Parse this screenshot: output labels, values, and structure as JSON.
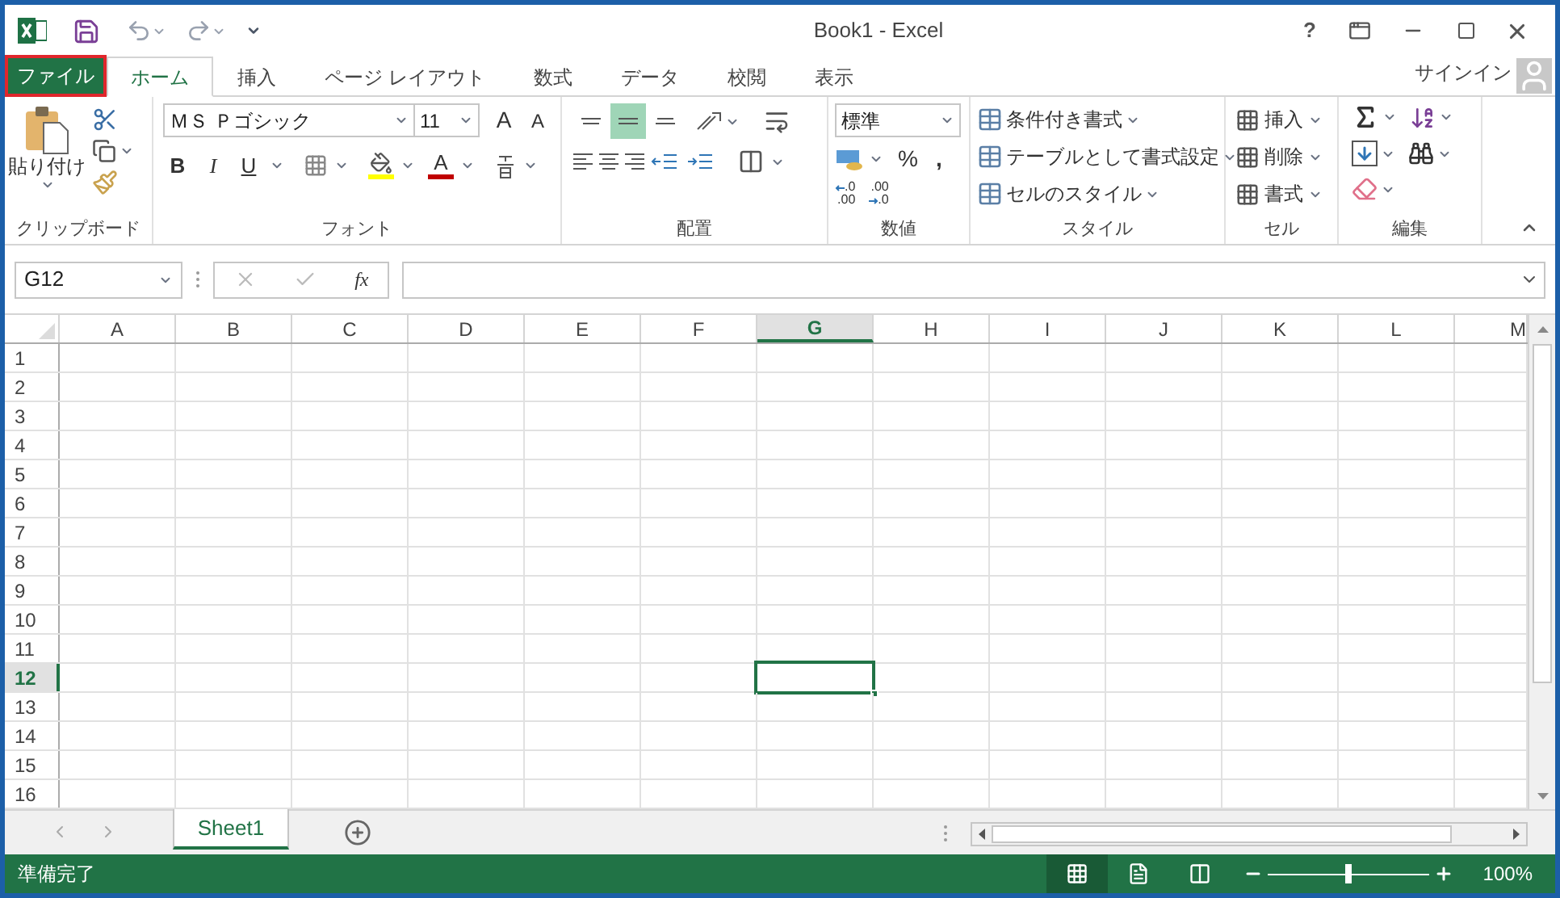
{
  "window": {
    "title": "Book1 - Excel",
    "help": "?"
  },
  "sign_in": "サインイン",
  "tabs": [
    {
      "label": "ファイル",
      "kind": "file",
      "selected": false
    },
    {
      "label": "ホーム",
      "kind": "tab",
      "selected": true
    },
    {
      "label": "挿入",
      "kind": "tab",
      "selected": false
    },
    {
      "label": "ページ レイアウト",
      "kind": "tab",
      "selected": false
    },
    {
      "label": "数式",
      "kind": "tab",
      "selected": false
    },
    {
      "label": "データ",
      "kind": "tab",
      "selected": false
    },
    {
      "label": "校閲",
      "kind": "tab",
      "selected": false
    },
    {
      "label": "表示",
      "kind": "tab",
      "selected": false
    }
  ],
  "ribbon": {
    "clipboard": {
      "label": "クリップボード",
      "paste": "貼り付け"
    },
    "font": {
      "label": "フォント",
      "font_name": "ＭＳ Ｐゴシック",
      "font_size": "11",
      "grow": "A",
      "shrink": "A",
      "bold": "B",
      "italic": "I",
      "underline": "U",
      "font_color": "A"
    },
    "alignment": {
      "label": "配置",
      "vertical": [
        {
          "kind": "top",
          "selected": false
        },
        {
          "kind": "middle",
          "selected": true
        },
        {
          "kind": "bottom",
          "selected": false
        }
      ]
    },
    "number": {
      "label": "数値",
      "format": "標準",
      "percent": "%",
      "comma": ",",
      "decimals": [
        {
          "kind": "increase",
          "top": ".0",
          "bottom": ".00"
        },
        {
          "kind": "decrease",
          "top": ".00",
          "bottom": ".0"
        }
      ]
    },
    "styles": {
      "label": "スタイル",
      "items": [
        "条件付き書式",
        "テーブルとして書式設定",
        "セルのスタイル"
      ]
    },
    "cells": {
      "label": "セル",
      "items": [
        "挿入",
        "削除",
        "書式"
      ]
    },
    "editing": {
      "label": "編集"
    }
  },
  "formula_bar": {
    "name_box": "G12",
    "function_label": "fx"
  },
  "sheet": {
    "columns": [
      {
        "label": "A",
        "selected": false
      },
      {
        "label": "B",
        "selected": false
      },
      {
        "label": "C",
        "selected": false
      },
      {
        "label": "D",
        "selected": false
      },
      {
        "label": "E",
        "selected": false
      },
      {
        "label": "F",
        "selected": false
      },
      {
        "label": "G",
        "selected": true
      },
      {
        "label": "H",
        "selected": false
      },
      {
        "label": "I",
        "selected": false
      },
      {
        "label": "J",
        "selected": false
      },
      {
        "label": "K",
        "selected": false
      },
      {
        "label": "L",
        "selected": false
      },
      {
        "label": "M",
        "selected": false
      }
    ],
    "rows": [
      {
        "label": "1",
        "selected": false
      },
      {
        "label": "2",
        "selected": false
      },
      {
        "label": "3",
        "selected": false
      },
      {
        "label": "4",
        "selected": false
      },
      {
        "label": "5",
        "selected": false
      },
      {
        "label": "6",
        "selected": false
      },
      {
        "label": "7",
        "selected": false
      },
      {
        "label": "8",
        "selected": false
      },
      {
        "label": "9",
        "selected": false
      },
      {
        "label": "10",
        "selected": false
      },
      {
        "label": "11",
        "selected": false
      },
      {
        "label": "12",
        "selected": true
      },
      {
        "label": "13",
        "selected": false
      },
      {
        "label": "14",
        "selected": false
      },
      {
        "label": "15",
        "selected": false
      },
      {
        "label": "16",
        "selected": false
      }
    ]
  },
  "sheet_tabs": [
    {
      "label": "Sheet1",
      "selected": true
    }
  ],
  "status_bar": {
    "text": "準備完了",
    "views": [
      {
        "kind": "normal",
        "selected": true
      },
      {
        "kind": "page_layout",
        "selected": false
      },
      {
        "kind": "page_break",
        "selected": false
      }
    ],
    "zoom": {
      "level": 0.5,
      "reading": "100%"
    }
  }
}
